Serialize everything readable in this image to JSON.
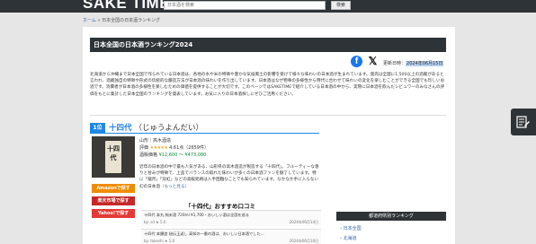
{
  "header": {
    "logo": "SAKE TIME",
    "search_placeholder": "日本酒を検索",
    "search_button": "検索"
  },
  "breadcrumb": {
    "home": "ホーム",
    "separator": "»",
    "current": "日本全国の日本酒ランキング"
  },
  "page": {
    "title": "日本全国の日本酒ランキング2024",
    "updated_label": "更新日時：",
    "updated_date": "2024年06月15日",
    "intro": "北海道から沖縄まで日本全国で作られている日本酒は、各地の水や米の特徴や豊かな気候風土の影響を受けて様々な味わいの日本酒が生まれています。発売は全国に1,500以上の酒蔵があると言われ、酒蔵独自の特徴や形式の伝統的な醸造方法が日本酒の味わいを作り出しています。日本酒はなぜ物事の多様性から時代に合わせて味わいの変化を楽しむことができる全国でも珍しいお酒です。消費者が日本酒の多様性を楽しむための価値を提供することが大切です。このページではSAKETIMEで紹介している日本酒の中から、実際に日本酒を飲んだレビュワーのみなさんの評価をもとに集計した日本全国のランキングを発表しています。お気に入りの日本酒探しにぜひご活用ください。",
    "colors": {
      "accent": "#1e88e5",
      "header": "#2d3336"
    }
  },
  "share": {
    "facebook_icon": "f",
    "x_icon": "𝕏"
  },
  "ranking": [
    {
      "rank": "1位",
      "name": "十四代",
      "reading": "（じゅうよんだい）",
      "label_glyph": "十四代",
      "region": "山形｜高木酒造",
      "rating_label": "評価",
      "stars": "★★★★★",
      "rating": "4.61点（2659件）",
      "price_label": "酒販価格",
      "price": "¥12,600 〜 ¥473,080",
      "description": "近年の日本酒の中で最も人気がある、山形県の高木酒造が製造する「十四代」。フルーティーな香りと甘みが特徴で、上品でバランスの取れた味わいが多くの日本酒ファンを魅了しています。特に「龍月」「双虹」などの高級銘柄は入手困難なことでも知られています。なかなか手に入らない幻の日本酒",
      "more": "（もっと見る）",
      "buy": {
        "amazon": "Amazonで探す",
        "rakuten": "楽天市場で探す",
        "yahoo": "Yahoo!で探す"
      },
      "reviews": {
        "title": "「十四代」おすすめ口コミ",
        "items": [
          {
            "text": "十四代 本丸 純米酒 720ml ¥1,700・おいしい酒は全国を巡る",
            "user": "by: sd ★ 5.0",
            "date": "2024年06月14日"
          },
          {
            "text": "十四代 本醸造 秘伝玉返し 高知の一番の酒は、おいしい日本酒でした…",
            "user": "by: takeshi ★ 5.0",
            "date": "2024年06月10日"
          }
        ]
      }
    }
  ],
  "sidebar": {
    "header": "都道府県別ランキング",
    "links": [
      "日本全国",
      "北海道"
    ]
  },
  "float_button": {
    "icon": "edit-note-icon"
  }
}
